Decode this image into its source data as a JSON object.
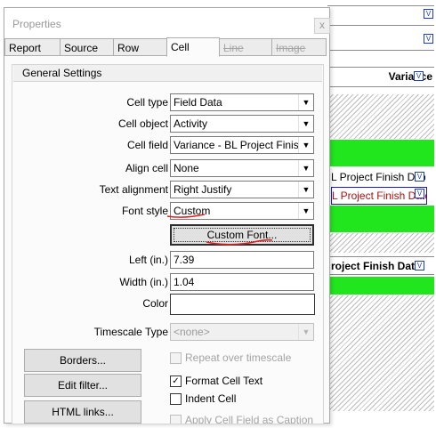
{
  "dialog": {
    "title": "Properties",
    "close_glyph": "x"
  },
  "tabs": [
    {
      "label": "Report",
      "state": "normal"
    },
    {
      "label": "Source",
      "state": "normal"
    },
    {
      "label": "Row",
      "state": "normal"
    },
    {
      "label": "Cell",
      "state": "active"
    },
    {
      "label": "Line",
      "state": "disabled"
    },
    {
      "label": "Image",
      "state": "disabled"
    }
  ],
  "section": {
    "title": "General Settings"
  },
  "fields": {
    "cell_type": {
      "label": "Cell type",
      "value": "Field Data"
    },
    "cell_object": {
      "label": "Cell object",
      "value": "Activity"
    },
    "cell_field": {
      "label": "Cell field",
      "value": "Variance - BL Project Finish D"
    },
    "align_cell": {
      "label": "Align cell",
      "value": "None"
    },
    "text_alignment": {
      "label": "Text alignment",
      "value": "Right Justify"
    },
    "font_style": {
      "label": "Font style",
      "value": "Custom"
    },
    "left": {
      "label": "Left (in.)",
      "value": "7.39"
    },
    "width": {
      "label": "Width (in.)",
      "value": "1.04"
    },
    "color": {
      "label": "Color",
      "value": ""
    },
    "timescale_type": {
      "label": "Timescale Type",
      "value": "<none>"
    }
  },
  "buttons": {
    "custom_font": "Custom Font...",
    "borders": "Borders...",
    "edit_filter": "Edit filter...",
    "html_links": "HTML links..."
  },
  "checkboxes": {
    "repeat_over_timescale": {
      "label": "Repeat over timescale",
      "checked": false,
      "enabled": false
    },
    "format_cell_text": {
      "label": "Format Cell Text",
      "checked": true,
      "enabled": true
    },
    "indent_cell": {
      "label": "Indent Cell",
      "checked": false,
      "enabled": true
    },
    "apply_cell_field_caption": {
      "label": "Apply Cell Field as Caption",
      "checked": false,
      "enabled": false
    }
  },
  "background": {
    "header_text": "Variance",
    "cell_1": "L Project Finish Date",
    "cell_2": "L Project Finish Date",
    "cell_3": "roject Finish Date",
    "marker_glyph": "V",
    "colors": {
      "green": "#22e61d",
      "selection": "#1d1da8",
      "annotation_red": "#e02020"
    }
  },
  "glyphs": {
    "arrow_down": "▼",
    "check": "✓"
  }
}
